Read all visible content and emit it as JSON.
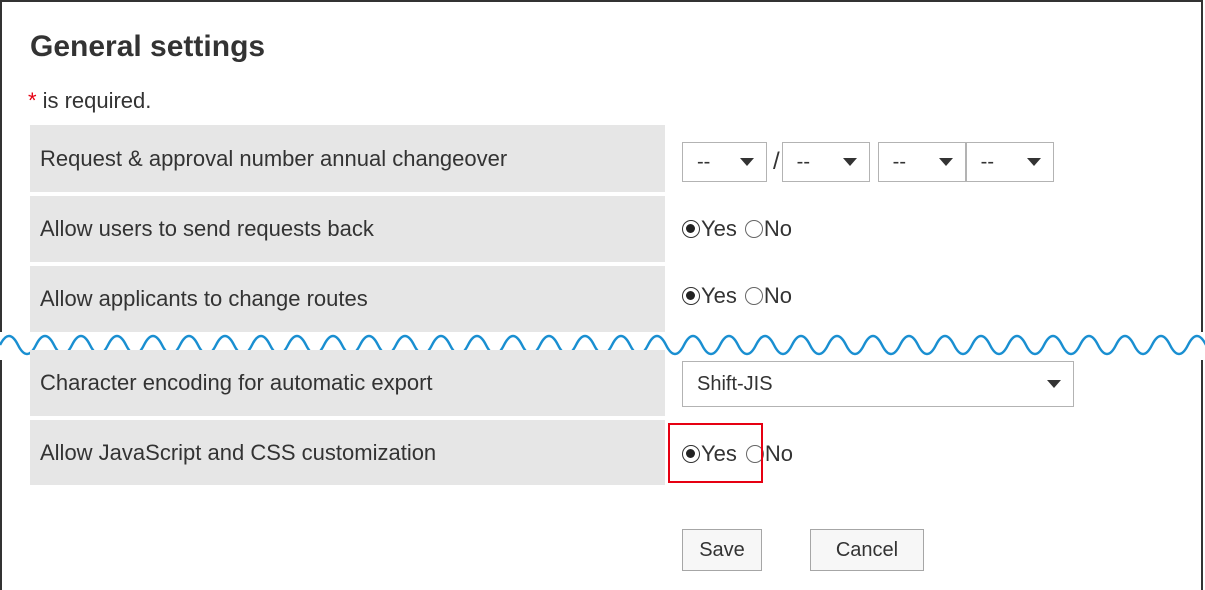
{
  "page": {
    "title": "General settings",
    "required_star": "*",
    "required_text": "is required."
  },
  "rows": {
    "annual_changeover": {
      "label": "Request & approval number annual changeover",
      "selects": [
        "--",
        "--",
        "--",
        "--"
      ],
      "separator": "/"
    },
    "send_back": {
      "label": "Allow users to send requests back",
      "yes": "Yes",
      "no": "No",
      "selected": "Yes"
    },
    "change_routes": {
      "label": "Allow applicants to change routes",
      "yes": "Yes",
      "no": "No",
      "selected": "Yes"
    },
    "encoding": {
      "label": "Character encoding for automatic export",
      "value": "Shift-JIS"
    },
    "js_css": {
      "label": "Allow JavaScript and CSS customization",
      "yes": "Yes",
      "no": "No",
      "selected": "Yes"
    }
  },
  "buttons": {
    "save": "Save",
    "cancel": "Cancel"
  },
  "colors": {
    "label_bg": "#e6e6e6",
    "highlight": "#e60012",
    "wave": "#1a8fd1",
    "required_star": "#e60012"
  }
}
